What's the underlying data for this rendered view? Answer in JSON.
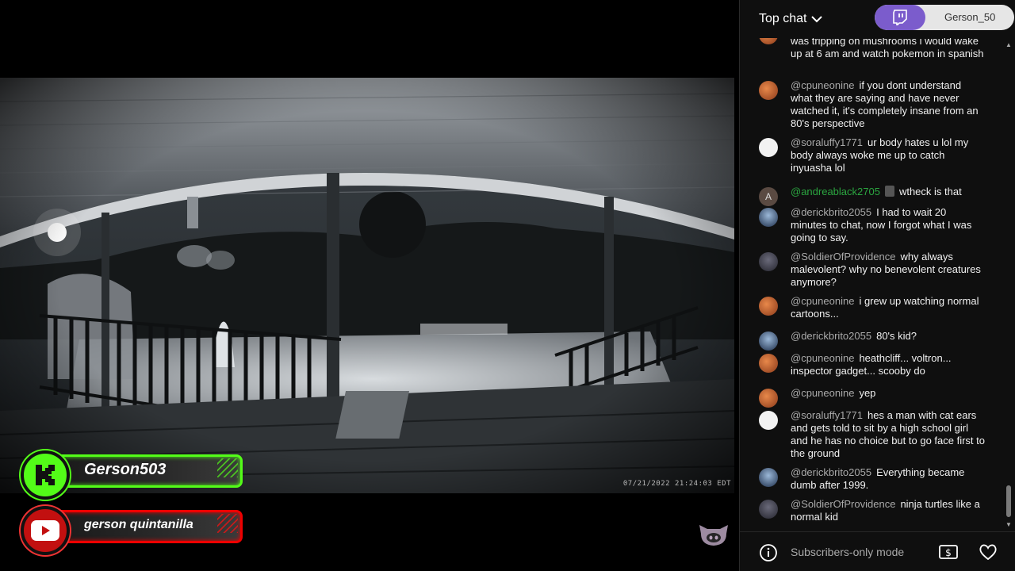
{
  "video": {
    "timestamp": "07/21/2022 21:24:03 EDT"
  },
  "socials": {
    "kick": {
      "name": "Gerson503",
      "icon": "kick-logo-icon",
      "color": "#53fc18"
    },
    "youtube": {
      "name": "gerson quintanilla",
      "icon": "youtube-logo-icon",
      "color": "#e00000"
    }
  },
  "chat": {
    "mode_label": "Top chat",
    "twitch_user": "Gerson_50",
    "footer_label": "Subscribers-only mode",
    "messages": [
      {
        "author": "",
        "text": "was tripping on mushrooms i would wake up at 6 am and watch pokemon in spanish",
        "avatar": "orange"
      },
      {
        "author": "@cpuneonine",
        "text": "if you dont understand what they are saying and have never watched it, it's completely insane from an 80's perspective",
        "avatar": "orange"
      },
      {
        "author": "@soraluffy1771",
        "text": "ur body hates u lol my body always woke me up to catch inyuasha lol",
        "avatar": "white"
      },
      {
        "author": "@andreablack2705",
        "text": "wtheck is that",
        "avatar": "a",
        "avatar_letter": "A",
        "member": true
      },
      {
        "author": "@derickbrito2055",
        "text": "I had to wait 20 minutes to chat, now I forgot what I was going to say.",
        "avatar": "blue"
      },
      {
        "author": "@SoldierOfProvidence",
        "text": "why always malevolent? why no benevolent creatures anymore?",
        "avatar": "dark"
      },
      {
        "author": "@cpuneonine",
        "text": "i grew up watching normal cartoons...",
        "avatar": "orange"
      },
      {
        "author": "@derickbrito2055",
        "text": "80's kid?",
        "avatar": "blue"
      },
      {
        "author": "@cpuneonine",
        "text": "heathcliff... voltron... inspector gadget... scooby do",
        "avatar": "orange"
      },
      {
        "author": "@cpuneonine",
        "text": "yep",
        "avatar": "orange"
      },
      {
        "author": "@soraluffy1771",
        "text": "hes a man with cat ears and gets told to sit by a high school girl and he has no choice but to go face first to the ground",
        "avatar": "white"
      },
      {
        "author": "@derickbrito2055",
        "text": "Everything became dumb after 1999.",
        "avatar": "blue"
      },
      {
        "author": "@SoldierOfProvidence",
        "text": "ninja turtles like a normal kid",
        "avatar": "dark"
      }
    ]
  }
}
